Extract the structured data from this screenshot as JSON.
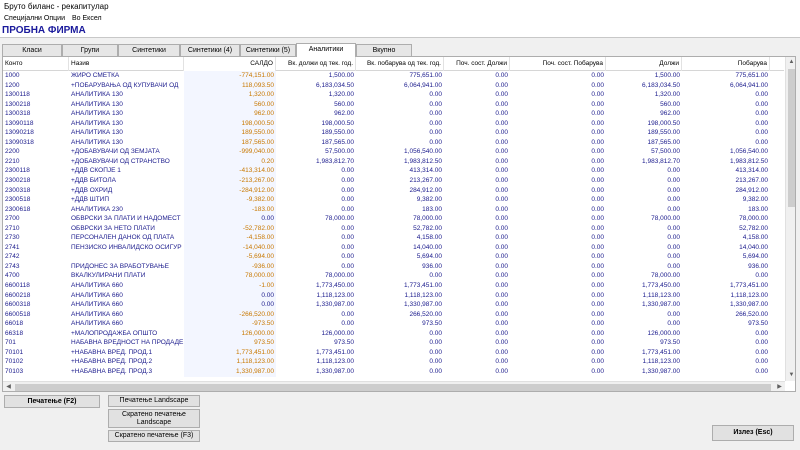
{
  "window": {
    "title": "Бруто биланс - рекапитулар"
  },
  "menu": [
    "Специјални Опции",
    "Во Ексел"
  ],
  "company": "ПРОБНА ФИРМА",
  "tabs": [
    {
      "label": "Класи",
      "active": false
    },
    {
      "label": "Групи",
      "active": false
    },
    {
      "label": "Синтетики",
      "active": false
    },
    {
      "label": "Синтетики (4)",
      "active": false
    },
    {
      "label": "Синтетики (5)",
      "active": false
    },
    {
      "label": "Аналитики",
      "active": true
    },
    {
      "label": "Вкупно",
      "active": false
    }
  ],
  "columns": [
    "Конто",
    "Назив",
    "САЛДО",
    "Вк. должи од тек. год.",
    "Вк. побарува од тек. год.",
    "Поч. сост. Должи",
    "Поч. сост. Побарува",
    "Должи",
    "Побарува"
  ],
  "rows": [
    [
      "1000",
      "ЖИРО СМЕТКА",
      "-774,151.00",
      "1,500.00",
      "775,651.00",
      "0.00",
      "0.00",
      "1,500.00",
      "775,651.00"
    ],
    [
      "1200",
      "+ПОБАРУВАЊА ОД КУПУВАЧИ ОД",
      "118,093.50",
      "6,183,034.50",
      "6,064,941.00",
      "0.00",
      "0.00",
      "6,183,034.50",
      "6,064,941.00"
    ],
    [
      "1300118",
      "АНАЛИТИКА 130",
      "1,320.00",
      "1,320.00",
      "0.00",
      "0.00",
      "0.00",
      "1,320.00",
      "0.00"
    ],
    [
      "1300218",
      "АНАЛИТИКА 130",
      "560.00",
      "560.00",
      "0.00",
      "0.00",
      "0.00",
      "560.00",
      "0.00"
    ],
    [
      "1300318",
      "АНАЛИТИКА 130",
      "962.00",
      "962.00",
      "0.00",
      "0.00",
      "0.00",
      "962.00",
      "0.00"
    ],
    [
      "13090118",
      "АНАЛИТИКА 130",
      "198,000.50",
      "198,000.50",
      "0.00",
      "0.00",
      "0.00",
      "198,000.50",
      "0.00"
    ],
    [
      "13090218",
      "АНАЛИТИКА 130",
      "189,550.00",
      "189,550.00",
      "0.00",
      "0.00",
      "0.00",
      "189,550.00",
      "0.00"
    ],
    [
      "13090318",
      "АНАЛИТИКА 130",
      "187,565.00",
      "187,565.00",
      "0.00",
      "0.00",
      "0.00",
      "187,565.00",
      "0.00"
    ],
    [
      "2200",
      "+ДОБАВУВАЧИ ОД ЗЕМЈАТА",
      "-999,040.00",
      "57,500.00",
      "1,056,540.00",
      "0.00",
      "0.00",
      "57,500.00",
      "1,056,540.00"
    ],
    [
      "2210",
      "+ДОБАВУВАЧИ ОД СТРАНСТВО",
      "0.20",
      "1,983,812.70",
      "1,983,812.50",
      "0.00",
      "0.00",
      "1,983,812.70",
      "1,983,812.50"
    ],
    [
      "2300118",
      "+ДДВ СКОПЈЕ 1",
      "-413,314.00",
      "0.00",
      "413,314.00",
      "0.00",
      "0.00",
      "0.00",
      "413,314.00"
    ],
    [
      "2300218",
      "+ДДВ БИТОЛА",
      "-213,267.00",
      "0.00",
      "213,267.00",
      "0.00",
      "0.00",
      "0.00",
      "213,267.00"
    ],
    [
      "2300318",
      "+ДДВ ОХРИД",
      "-284,912.00",
      "0.00",
      "284,912.00",
      "0.00",
      "0.00",
      "0.00",
      "284,912.00"
    ],
    [
      "2300518",
      "+ДДВ ШТИП",
      "-9,382.00",
      "0.00",
      "9,382.00",
      "0.00",
      "0.00",
      "0.00",
      "9,382.00"
    ],
    [
      "2300618",
      "АНАЛИТИКА 230",
      "-183.00",
      "0.00",
      "183.00",
      "0.00",
      "0.00",
      "0.00",
      "183.00"
    ],
    [
      "2700",
      "ОБВРСКИ ЗА ПЛАТИ И НАДОМЕСТ",
      "0.00",
      "78,000.00",
      "78,000.00",
      "0.00",
      "0.00",
      "78,000.00",
      "78,000.00"
    ],
    [
      "2710",
      "ОБВРСКИ ЗА НЕТО ПЛАТИ",
      "-52,782.00",
      "0.00",
      "52,782.00",
      "0.00",
      "0.00",
      "0.00",
      "52,782.00"
    ],
    [
      "2730",
      "ПЕРСОНАЛЕН ДАНОК ОД ПЛАТА",
      "-4,158.00",
      "0.00",
      "4,158.00",
      "0.00",
      "0.00",
      "0.00",
      "4,158.00"
    ],
    [
      "2741",
      "ПЕНЗИСКО ИНВАЛИДСКО ОСИГУР",
      "-14,040.00",
      "0.00",
      "14,040.00",
      "0.00",
      "0.00",
      "0.00",
      "14,040.00"
    ],
    [
      "2742",
      "",
      "-5,694.00",
      "0.00",
      "5,694.00",
      "0.00",
      "0.00",
      "0.00",
      "5,694.00"
    ],
    [
      "2743",
      "ПРИДОНЕС ЗА ВРАБОТУВАЊЕ",
      "-936.00",
      "0.00",
      "936.00",
      "0.00",
      "0.00",
      "0.00",
      "936.00"
    ],
    [
      "4700",
      "ВКАЛКУЛИРАНИ ПЛАТИ",
      "78,000.00",
      "78,000.00",
      "0.00",
      "0.00",
      "0.00",
      "78,000.00",
      "0.00"
    ],
    [
      "6600118",
      "АНАЛИТИКА 660",
      "-1.00",
      "1,773,450.00",
      "1,773,451.00",
      "0.00",
      "0.00",
      "1,773,450.00",
      "1,773,451.00"
    ],
    [
      "6600218",
      "АНАЛИТИКА 660",
      "0.00",
      "1,118,123.00",
      "1,118,123.00",
      "0.00",
      "0.00",
      "1,118,123.00",
      "1,118,123.00"
    ],
    [
      "6600318",
      "АНАЛИТИКА 660",
      "0.00",
      "1,330,987.00",
      "1,330,987.00",
      "0.00",
      "0.00",
      "1,330,987.00",
      "1,330,987.00"
    ],
    [
      "6600518",
      "АНАЛИТИКА 660",
      "-266,520.00",
      "0.00",
      "266,520.00",
      "0.00",
      "0.00",
      "0.00",
      "266,520.00"
    ],
    [
      "66018",
      "АНАЛИТИКА 660",
      "-973.50",
      "0.00",
      "973.50",
      "0.00",
      "0.00",
      "0.00",
      "973.50"
    ],
    [
      "66318",
      "+МАЛОПРОДАЖБА ОПШТО",
      "126,000.00",
      "126,000.00",
      "0.00",
      "0.00",
      "0.00",
      "126,000.00",
      "0.00"
    ],
    [
      "701",
      "НАБАВНА ВРЕДНОСТ НА ПРОДАДЕ",
      "973.50",
      "973.50",
      "0.00",
      "0.00",
      "0.00",
      "973.50",
      "0.00"
    ],
    [
      "70101",
      "+НАБАВНА  ВРЕД. ПРОД.1",
      "1,773,451.00",
      "1,773,451.00",
      "0.00",
      "0.00",
      "0.00",
      "1,773,451.00",
      "0.00"
    ],
    [
      "70102",
      "+НАБАВНА  ВРЕД. ПРОД.2",
      "1,118,123.00",
      "1,118,123.00",
      "0.00",
      "0.00",
      "0.00",
      "1,118,123.00",
      "0.00"
    ],
    [
      "70103",
      "+НАБАВНА  ВРЕД. ПРОД.3",
      "1,330,987.00",
      "1,330,987.00",
      "0.00",
      "0.00",
      "0.00",
      "1,330,987.00",
      "0.00"
    ]
  ],
  "buttons": {
    "print": "Печатење (F2)",
    "print_landscape": "Печатење Landscape",
    "short_landscape": "Скратено печатење Landscape",
    "short_print": "Скратено печатење (F3)",
    "exit": "Излез (Esc)"
  },
  "colors": {
    "text_blue": "#1a1a8c",
    "saldo_orange": "#c87800",
    "title_blue": "#1a1a9c"
  }
}
